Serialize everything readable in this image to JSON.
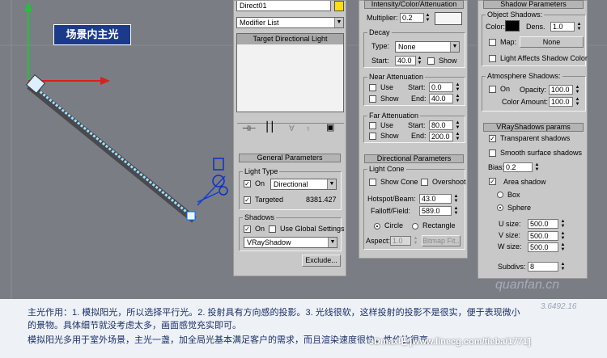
{
  "callout": {
    "text": "场景内主光"
  },
  "left_panel": {
    "name_field": "Direct01",
    "name_color": "#ffe000",
    "modifier_list": "Modifier List",
    "stack_item": "Target Directional Light",
    "general_title": "General Parameters",
    "light_type_label": "Light Type",
    "on_label": "On",
    "on_checked": true,
    "light_type_value": "Directional",
    "targeted_label": "Targeted",
    "targeted_checked": true,
    "targeted_distance": "8381.427",
    "shadows_label": "Shadows",
    "shadows_on_label": "On",
    "shadows_on_checked": true,
    "use_global_label": "Use Global Settings",
    "shadow_type": "VRayShadow",
    "exclude_button": "Exclude..."
  },
  "intensity_panel": {
    "title": "Intensity/Color/Attenuation",
    "multiplier_label": "Multiplier:",
    "multiplier_value": "0.2",
    "swatch_color": "#f5f5f5",
    "decay_label": "Decay",
    "type_label": "Type:",
    "type_value": "None",
    "start_label": "Start:",
    "start_value": "40.0",
    "show_label": "Show",
    "near_label": "Near Attenuation",
    "near_use": "Use",
    "near_show": "Show",
    "near_start_label": "Start:",
    "near_start_value": "0.0",
    "near_end_label": "End:",
    "near_end_value": "40.0",
    "far_label": "Far Attenuation",
    "far_use": "Use",
    "far_show": "Show",
    "far_start_label": "Start:",
    "far_start_value": "80.0",
    "far_end_label": "End:",
    "far_end_value": "200.0",
    "directional_title": "Directional Parameters",
    "light_cone_label": "Light Cone",
    "show_cone_label": "Show Cone",
    "overshoot_label": "Overshoot",
    "hotspot_label": "Hotspot/Beam:",
    "hotspot_value": "43.0",
    "falloff_label": "Falloff/Field:",
    "falloff_value": "589.0",
    "circle_label": "Circle",
    "rectangle_label": "Rectangle",
    "aspect_label": "Aspect:",
    "aspect_value": "1.0",
    "bitmap_fit_button": "Bitmap Fit..."
  },
  "shadow_panel": {
    "title": "Shadow Parameters",
    "object_shadows_label": "Object Shadows:",
    "color_label": "Color:",
    "shadow_color": "#000000",
    "dens_label": "Dens.",
    "dens_value": "1.0",
    "map_label": "Map:",
    "map_button": "None",
    "light_affects_label": "Light Affects Shadow Color",
    "atmosphere_label": "Atmosphere Shadows:",
    "atmo_on_label": "On",
    "opacity_label": "Opacity:",
    "opacity_value": "100.0",
    "color_amount_label": "Color Amount:",
    "color_amount_value": "100.0",
    "vray_title": "VRayShadows params",
    "transparent_label": "Transparent shadows",
    "transparent_checked": true,
    "smooth_label": "Smooth surface shadows",
    "bias_label": "Bias:",
    "bias_value": "0.2",
    "area_shadow_label": "Area shadow",
    "area_checked": true,
    "box_label": "Box",
    "sphere_label": "Sphere",
    "u_size_label": "U size:",
    "u_size_value": "500.0",
    "v_size_label": "V size:",
    "v_size_value": "500.0",
    "w_size_label": "W size:",
    "w_size_value": "500.0",
    "subdivs_label": "Subdivs:",
    "subdivs_value": "8"
  },
  "caption": {
    "line1": "主光作用：1. 模拟阳光，所以选择平行光。2. 投射具有方向感的投影。3. 光线很软，这样投射的投影不是很实，便于表现微小",
    "line2": "的景物。具体细节就没考虑太多，画面感觉充实即可。",
    "line3": "模拟阳光多用于室外场景，主光一盏，加全局光基本满足客户的需求，而且渲染速度很快，性价比很高。"
  },
  "watermark": {
    "site": "quanfan.cn",
    "number": "3.6492.16"
  },
  "footer": {
    "text": "3Dmax吧 [www.linecg.com/tieba/1771]"
  }
}
